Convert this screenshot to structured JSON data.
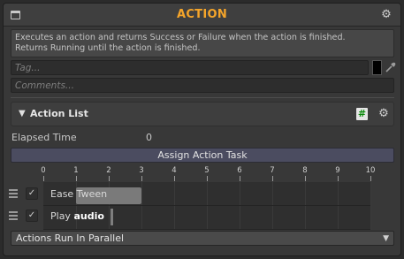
{
  "header": {
    "title": "ACTION",
    "window_icon": "window-icon",
    "settings_icon": "gear-icon"
  },
  "description": {
    "line1": "Executes an action and returns Success or Failure when the action is finished.",
    "line2": "Returns Running until the action is finished."
  },
  "tag": {
    "placeholder": "Tag...",
    "value": "",
    "color": "#000000",
    "picker_icon": "eyedropper-icon"
  },
  "comments": {
    "placeholder": "Comments...",
    "value": ""
  },
  "action_list": {
    "label": "Action List",
    "expanded": true,
    "hash_icon": "hash-icon",
    "settings_icon": "gear-icon"
  },
  "elapsed": {
    "label": "Elapsed Time",
    "value": "0"
  },
  "assign_button": {
    "label": "Assign Action Task"
  },
  "timeline": {
    "ticks": [
      "0",
      "1",
      "2",
      "3",
      "4",
      "5",
      "6",
      "7",
      "8",
      "9",
      "10"
    ],
    "actions": [
      {
        "checked": true,
        "name": "Ease Tween",
        "bold_part": "",
        "start": 1.0,
        "end": 3.0
      },
      {
        "checked": true,
        "name": "Play ",
        "bold_part": "audio",
        "start": 2.05,
        "end": 2.1
      }
    ]
  },
  "run_mode": {
    "selected": "Actions Run In Parallel"
  },
  "colors": {
    "title_accent": "#f5a52a",
    "assign_button_bg": "#4b4c60",
    "hash_icon_fg": "#0a8a0a"
  }
}
